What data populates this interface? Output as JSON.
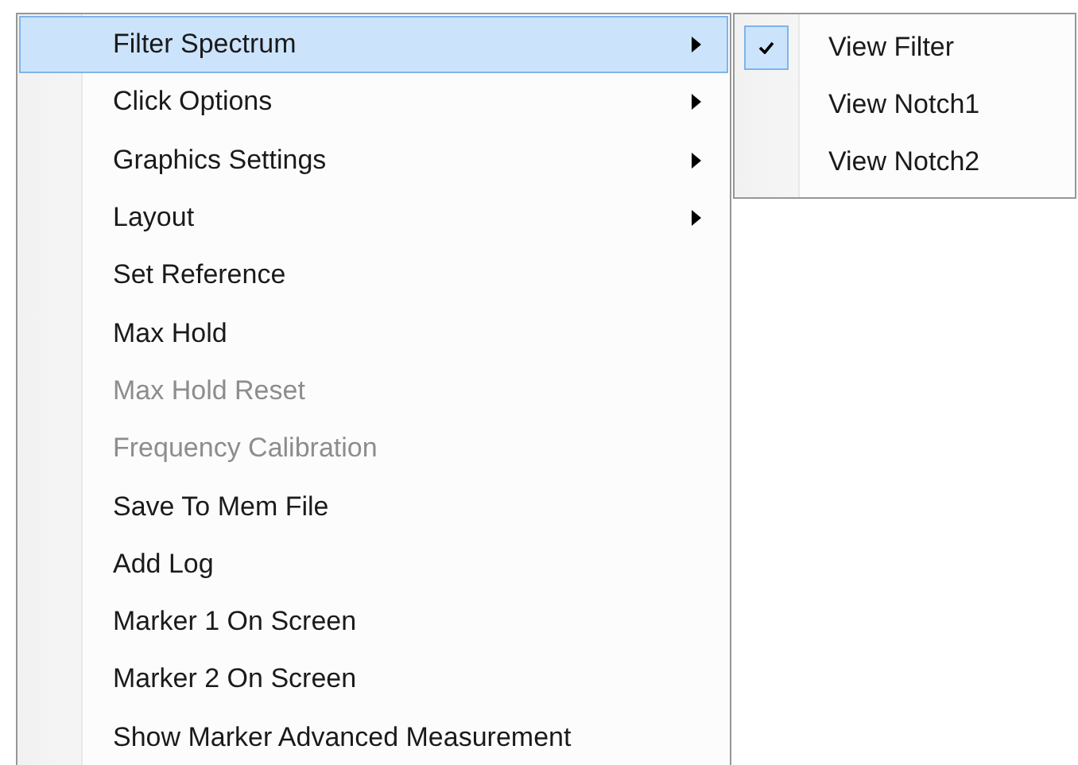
{
  "menu": {
    "items": [
      {
        "label": "Filter Spectrum",
        "kind": "submenu",
        "selected": true,
        "disabled": false
      },
      {
        "label": "Click Options",
        "kind": "submenu",
        "selected": false,
        "disabled": false
      },
      {
        "label": "Graphics Settings",
        "kind": "submenu",
        "selected": false,
        "disabled": false
      },
      {
        "label": "Layout",
        "kind": "submenu",
        "selected": false,
        "disabled": false
      },
      {
        "label": "Set Reference",
        "kind": "command",
        "selected": false,
        "disabled": false
      },
      {
        "label": "Max Hold",
        "kind": "command",
        "selected": false,
        "disabled": false
      },
      {
        "label": "Max Hold Reset",
        "kind": "command",
        "selected": false,
        "disabled": true
      },
      {
        "label": "Frequency Calibration",
        "kind": "command",
        "selected": false,
        "disabled": true
      },
      {
        "label": "Save To Mem File",
        "kind": "command",
        "selected": false,
        "disabled": false
      },
      {
        "label": "Add Log",
        "kind": "command",
        "selected": false,
        "disabled": false
      },
      {
        "label": "Marker 1 On Screen",
        "kind": "command",
        "selected": false,
        "disabled": false
      },
      {
        "label": "Marker 2 On Screen",
        "kind": "command",
        "selected": false,
        "disabled": false
      },
      {
        "label": "Show Marker Advanced Measurement",
        "kind": "command",
        "selected": false,
        "disabled": false
      }
    ]
  },
  "submenu": {
    "items": [
      {
        "label": "View Filter",
        "checked": true
      },
      {
        "label": "View Notch1",
        "checked": false
      },
      {
        "label": "View Notch2",
        "checked": false
      }
    ]
  }
}
